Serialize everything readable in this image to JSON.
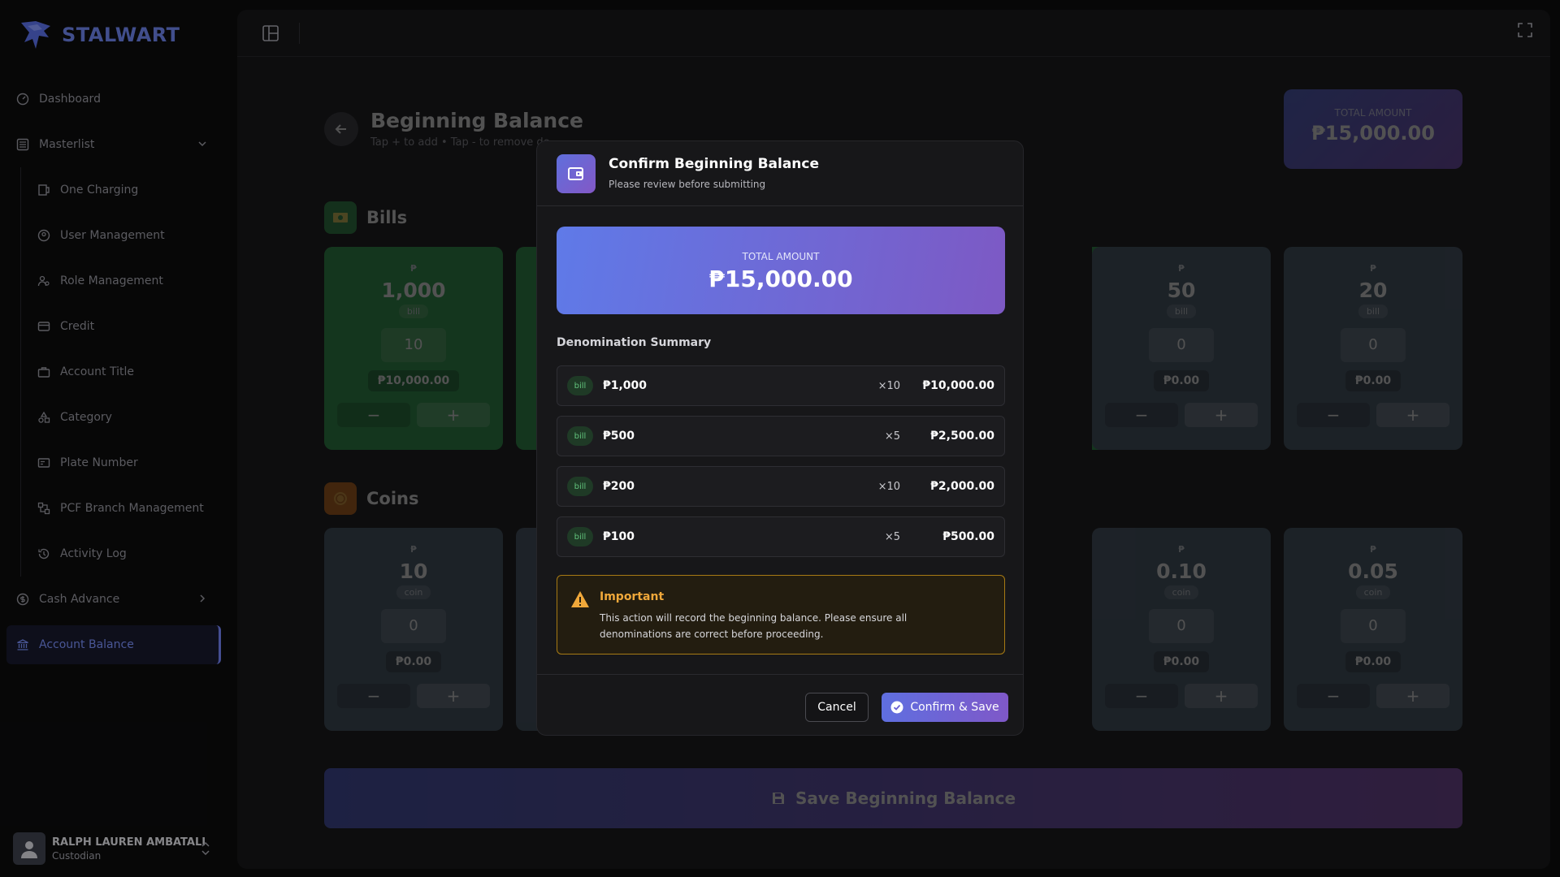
{
  "brand": {
    "name": "STALWART"
  },
  "sidebar": {
    "items": [
      {
        "label": "Dashboard",
        "icon": "dashboard-icon"
      },
      {
        "label": "Masterlist",
        "icon": "list-icon"
      },
      {
        "label": "One Charging",
        "icon": "receipt-icon"
      },
      {
        "label": "User Management",
        "icon": "user-icon"
      },
      {
        "label": "Role Management",
        "icon": "role-icon"
      },
      {
        "label": "Credit",
        "icon": "card-icon"
      },
      {
        "label": "Account Title",
        "icon": "briefcase-icon"
      },
      {
        "label": "Category",
        "icon": "category-icon"
      },
      {
        "label": "Plate Number",
        "icon": "plate-icon"
      },
      {
        "label": "PCF Branch Management",
        "icon": "branch-icon"
      },
      {
        "label": "Activity Log",
        "icon": "history-icon"
      },
      {
        "label": "Cash Advance",
        "icon": "cash-icon"
      },
      {
        "label": "Account Balance",
        "icon": "bank-icon"
      }
    ]
  },
  "user": {
    "name": "RALPH LAUREN AMBATALI",
    "role": "Custodian"
  },
  "page": {
    "title": "Beginning Balance",
    "subtitle": "Tap + to add • Tap - to remove de",
    "total_label": "TOTAL AMOUNT",
    "total_value": "₱15,000.00",
    "bills_title": "Bills",
    "coins_title": "Coins",
    "save_label": "Save Beginning Balance"
  },
  "bills": [
    {
      "currency": "₱",
      "value": "1,000",
      "type": "bill",
      "qty": "10",
      "subtotal": "₱10,000.00"
    },
    {
      "currency": "₱",
      "value": "50",
      "type": "bill",
      "qty": "0",
      "subtotal": "₱0.00"
    },
    {
      "currency": "₱",
      "value": "20",
      "type": "bill",
      "qty": "0",
      "subtotal": "₱0.00"
    }
  ],
  "coins": [
    {
      "currency": "₱",
      "value": "10",
      "type": "coin",
      "qty": "0",
      "subtotal": "₱0.00"
    },
    {
      "currency": "₱",
      "value": "0.10",
      "type": "coin",
      "qty": "0",
      "subtotal": "₱0.00"
    },
    {
      "currency": "₱",
      "value": "0.05",
      "type": "coin",
      "qty": "0",
      "subtotal": "₱0.00"
    }
  ],
  "modal": {
    "title": "Confirm Beginning Balance",
    "subtitle": "Please review before submitting",
    "total_label": "TOTAL AMOUNT",
    "total_value": "₱15,000.00",
    "summary_title": "Denomination Summary",
    "rows": [
      {
        "badge": "bill",
        "name": "₱1,000",
        "qty": "×10",
        "amount": "₱10,000.00"
      },
      {
        "badge": "bill",
        "name": "₱500",
        "qty": "×5",
        "amount": "₱2,500.00"
      },
      {
        "badge": "bill",
        "name": "₱200",
        "qty": "×10",
        "amount": "₱2,000.00"
      },
      {
        "badge": "bill",
        "name": "₱100",
        "qty": "×5",
        "amount": "₱500.00"
      }
    ],
    "notice_title": "Important",
    "notice_text": "This action will record the beginning balance. Please ensure all denominations are correct before proceeding.",
    "cancel_label": "Cancel",
    "confirm_label": "Confirm & Save"
  },
  "colors": {
    "accent": "#5f6fe0",
    "brand": "#6478d8",
    "bill_filled": "#2fa24c",
    "denom_empty": "#4b5d6e",
    "warning": "#f0a83a"
  }
}
